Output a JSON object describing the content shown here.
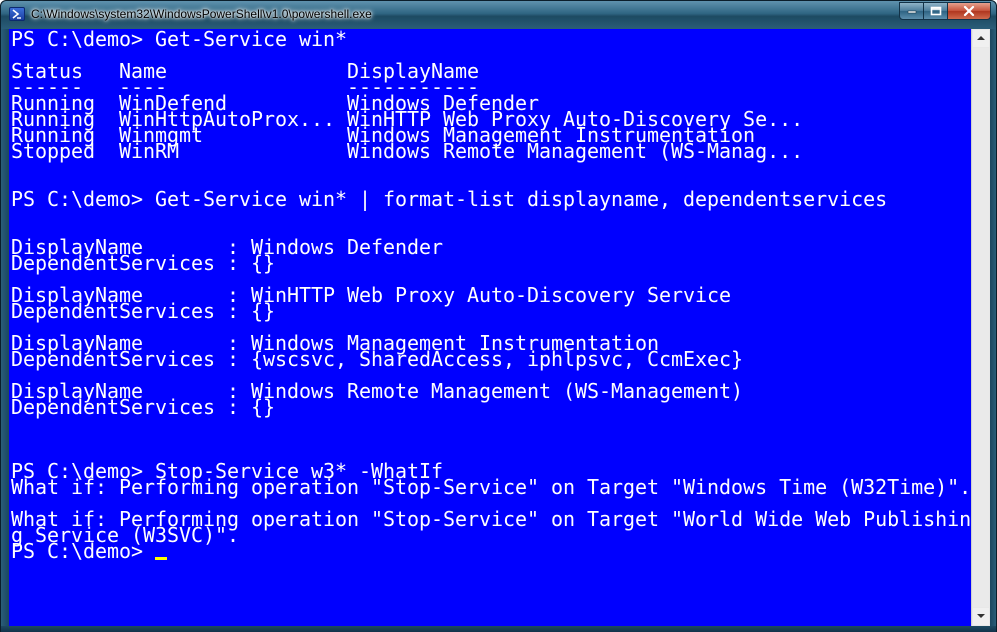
{
  "window": {
    "title": "C:\\Windows\\system32\\WindowsPowerShell\\v1.0\\powershell.exe"
  },
  "console": {
    "lines": [
      "PS C:\\demo> Get-Service win*",
      "",
      "Status   Name               DisplayName",
      "------   ----               -----------",
      "Running  WinDefend          Windows Defender",
      "Running  WinHttpAutoProx... WinHTTP Web Proxy Auto-Discovery Se...",
      "Running  Winmgmt            Windows Management Instrumentation",
      "Stopped  WinRM              Windows Remote Management (WS-Manag...",
      "",
      "",
      "PS C:\\demo> Get-Service win* | format-list displayname, dependentservices",
      "",
      "",
      "DisplayName       : Windows Defender",
      "DependentServices : {}",
      "",
      "DisplayName       : WinHTTP Web Proxy Auto-Discovery Service",
      "DependentServices : {}",
      "",
      "DisplayName       : Windows Management Instrumentation",
      "DependentServices : {wscsvc, SharedAccess, iphlpsvc, CcmExec}",
      "",
      "DisplayName       : Windows Remote Management (WS-Management)",
      "DependentServices : {}",
      "",
      "",
      "",
      "PS C:\\demo> Stop-Service w3* -WhatIf",
      "What if: Performing operation \"Stop-Service\" on Target \"Windows Time (W32Time)\".",
      "",
      "What if: Performing operation \"Stop-Service\" on Target \"World Wide Web Publishin",
      "g Service (W3SVC)\".",
      "PS C:\\demo> "
    ]
  },
  "colors": {
    "console_background": "#0000ff",
    "console_text": "#ffffff",
    "cursor": "#ffff00"
  },
  "icons": {
    "app": "powershell-icon",
    "minimize": "minimize-icon",
    "maximize": "maximize-icon",
    "close": "close-icon",
    "scroll_up": "arrow-up-icon",
    "scroll_down": "arrow-down-icon"
  }
}
